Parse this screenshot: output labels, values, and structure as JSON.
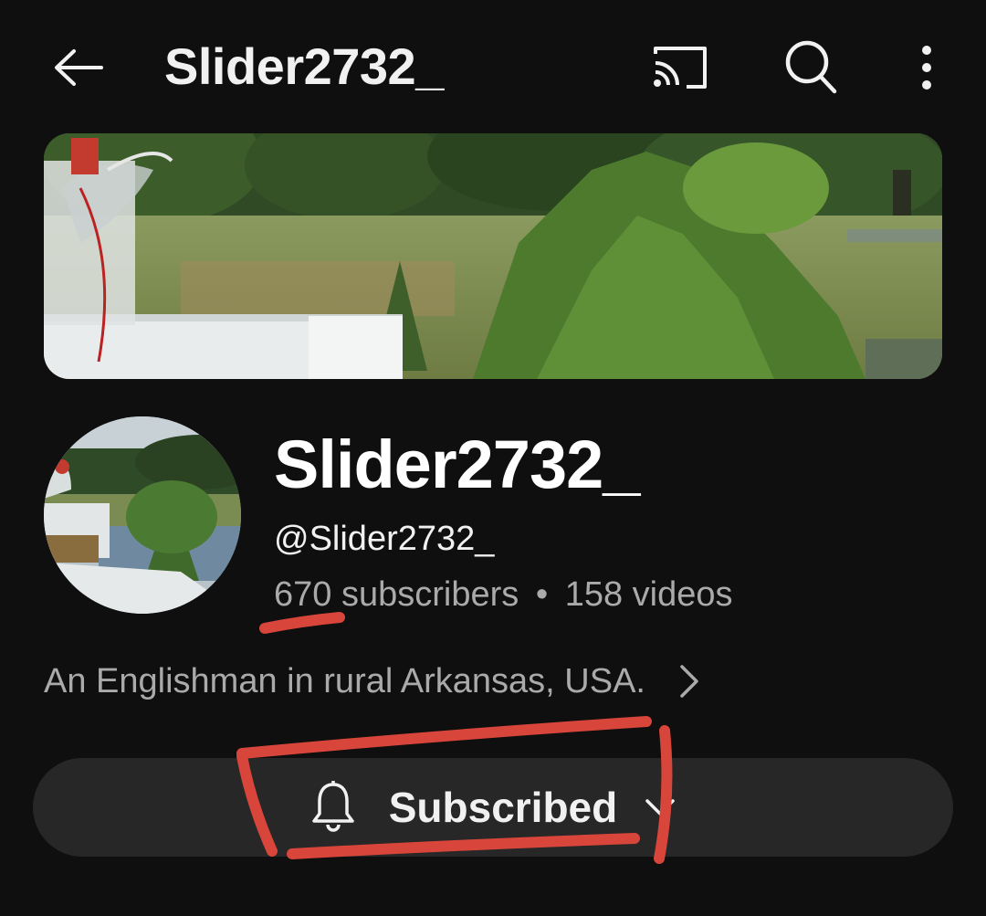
{
  "header": {
    "title": "Slider2732_",
    "icons": [
      "back-arrow-icon",
      "cast-icon",
      "search-icon",
      "more-vert-icon"
    ]
  },
  "channel": {
    "name": "Slider2732_",
    "handle": "@Slider2732_",
    "subscriber_count": "670",
    "subscribers_suffix": "subscribers",
    "separator": "•",
    "videos": "158 videos",
    "description": "An Englishman in rural Arkansas, USA."
  },
  "subscribe_button": {
    "label": "Subscribed",
    "icon": "bell-icon",
    "dropdown_icon": "chevron-down-icon"
  },
  "colors": {
    "background": "#0f0f0f",
    "button_bg": "#272727",
    "secondary_text": "#aaaaaa",
    "annotation_red": "#d8453a"
  }
}
